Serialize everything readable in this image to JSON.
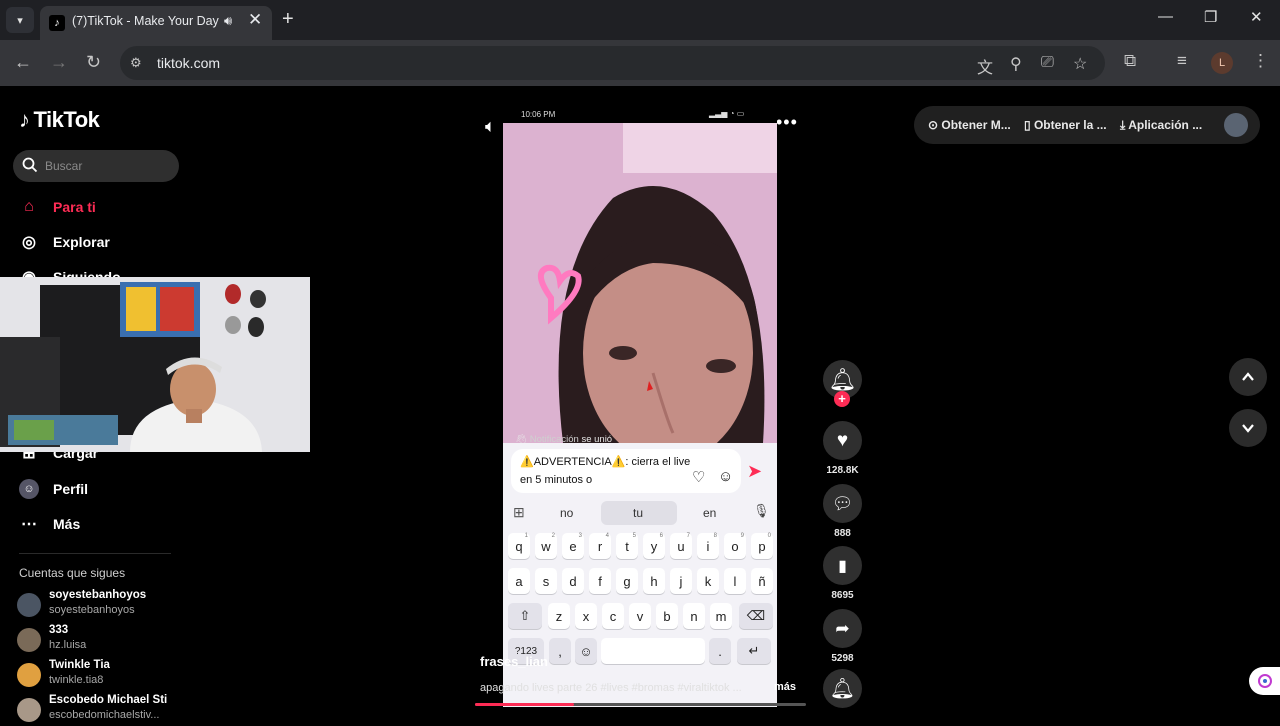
{
  "browser": {
    "tab_title": "(7)TikTok - Make Your Day",
    "url": "tiktok.com",
    "profile_initial": "L"
  },
  "sidebar": {
    "logo_text": "TikTok",
    "search_placeholder": "Buscar",
    "nav": [
      {
        "label": "Para ti",
        "icon": "home-icon",
        "active": true
      },
      {
        "label": "Explorar",
        "icon": "compass-icon"
      },
      {
        "label": "Siguiendo",
        "icon": "following-icon"
      },
      {
        "label": "Cargar",
        "icon": "upload-icon"
      },
      {
        "label": "Perfil",
        "icon": "profile-icon"
      },
      {
        "label": "Más",
        "icon": "more-icon"
      }
    ],
    "following_title": "Cuentas que sigues",
    "accounts": [
      {
        "name": "soyestebanhoyos",
        "user": "soyestebanhoyos"
      },
      {
        "name": "333",
        "user": "hz.luisa"
      },
      {
        "name": "Twinkle Tia",
        "user": "twinkle.tia8"
      },
      {
        "name": "Escobedo Michael Sti",
        "user": "escobedomichaelstiv..."
      }
    ]
  },
  "video": {
    "phone_time": "10:06 PM",
    "notification": "Notificación",
    "notification_action": "se unió",
    "input_text_1": "⚠️ADVERTENCIA⚠️: cierra el live",
    "input_text_2": "en 5 minutos o",
    "suggestions": [
      "no",
      "tu",
      "en"
    ],
    "keyboard_rows": [
      [
        "q",
        "w",
        "e",
        "r",
        "t",
        "y",
        "u",
        "i",
        "o",
        "p"
      ],
      [
        "a",
        "s",
        "d",
        "f",
        "g",
        "h",
        "j",
        "k",
        "l",
        "ñ"
      ],
      [
        "z",
        "x",
        "c",
        "v",
        "b",
        "n",
        "m"
      ]
    ],
    "key_numbers": [
      "1",
      "2",
      "3",
      "4",
      "5",
      "6",
      "7",
      "8",
      "9",
      "0"
    ],
    "symbols_key": "?123",
    "period_key": ".",
    "comma_key": ",",
    "author": "frases_lian",
    "caption": "apagando lives parte 26 #lives #bromas #viraltiktok ...",
    "caption_more": "más",
    "progress": 0.3
  },
  "actions": {
    "likes": "128.8K",
    "comments": "888",
    "saves": "8695",
    "shares": "5298"
  },
  "get_bar": {
    "item1": "Obtener M...",
    "item2": "Obtener la ...",
    "item3": "Aplicación ..."
  },
  "colors": {
    "accent": "#fe2c55",
    "background": "#000000",
    "chrome_dark": "#1f2024",
    "chrome_toolbar": "#35363a"
  }
}
